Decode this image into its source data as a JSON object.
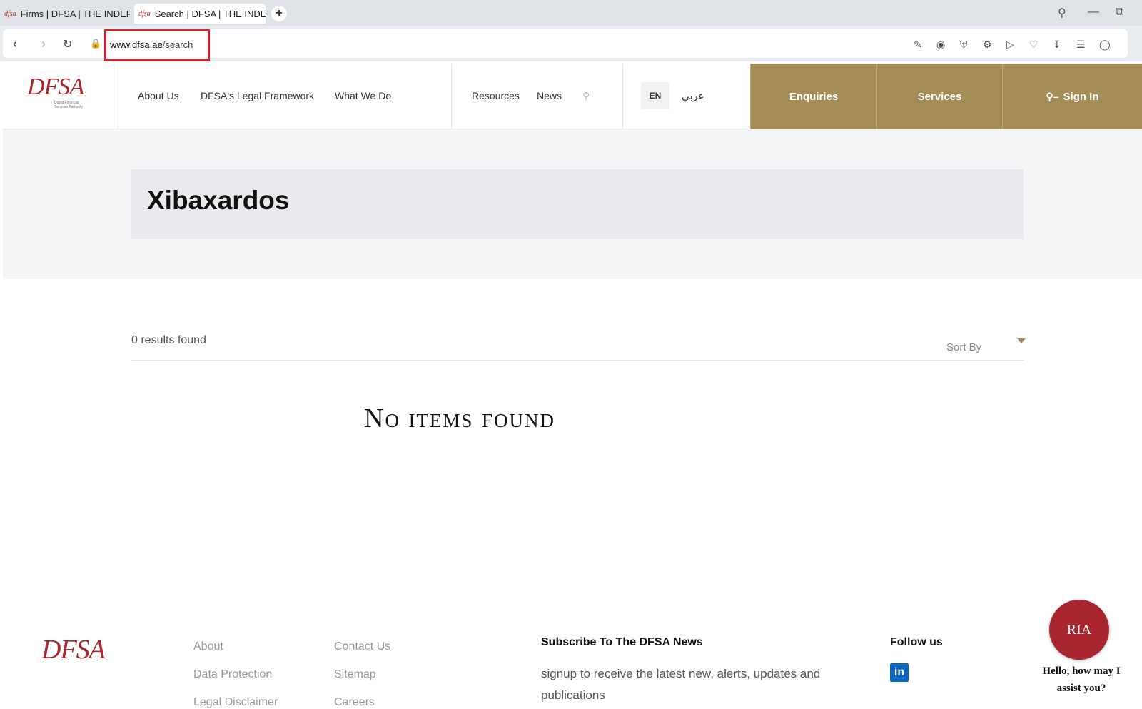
{
  "browser": {
    "tabs": [
      {
        "favicon": "dfsa",
        "label": "Firms | DFSA | THE INDEPE"
      },
      {
        "favicon": "dfsa",
        "label": "Search | DFSA | THE INDEP"
      }
    ],
    "new_tab": "+",
    "url_domain": "www.dfsa.ae",
    "url_path": "/search",
    "toolbar_icons": [
      "edit-icon",
      "camera-icon",
      "shield-icon",
      "translate-icon",
      "play-icon",
      "heart-icon",
      "download-icon",
      "menu-icon",
      "profile-icon"
    ]
  },
  "header": {
    "logo_text": "DFSA",
    "logo_sub": "Dubai Financial Services Authority",
    "nav_left": [
      "About Us",
      "DFSA's Legal Framework",
      "What We Do"
    ],
    "nav_mid": [
      "Resources",
      "News"
    ],
    "lang_en": "EN",
    "lang_ar": "عربي",
    "enquiries": "Enquiries",
    "services": "Services",
    "sign_in": "Sign In",
    "accent_color": "#a38c56"
  },
  "hero": {
    "title": "Xibaxardos"
  },
  "results": {
    "count_text": "0 results found",
    "sort_label": "Sort By",
    "empty_text": "No items found"
  },
  "footer": {
    "logo_text": "DFSA",
    "col1": [
      "About",
      "Data Protection",
      "Legal Disclaimer"
    ],
    "col2": [
      "Contact Us",
      "Sitemap",
      "Careers"
    ],
    "subscribe_title": "Subscribe To The DFSA News",
    "subscribe_text": "signup to receive the latest new, alerts, updates and publications",
    "follow_title": "Follow us",
    "linkedin": "in"
  },
  "chatbot": {
    "label": "RIA",
    "message": "Hello, how may I assist you?"
  }
}
